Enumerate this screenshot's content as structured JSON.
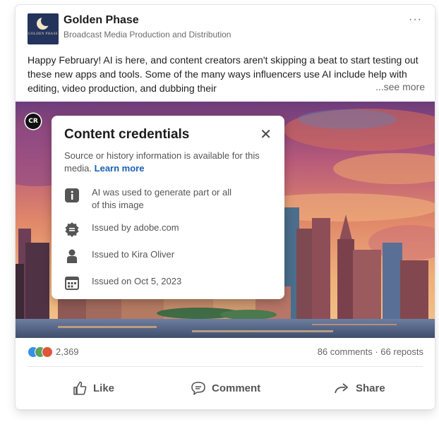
{
  "post": {
    "author": {
      "name": "Golden Phase",
      "subtitle": "Broadcast Media Production and Distribution",
      "logo_text": "GOLDEN PHASE"
    },
    "more_label": "···",
    "text": "Happy February! AI is here, and content creators aren't skipping a beat to start testing out these new apps and tools. Some of the many ways influencers use AI include help with editing, video production, and dubbing their",
    "see_more": "...see more"
  },
  "credentials": {
    "badge": "CR",
    "title": "Content credentials",
    "close": "✕",
    "description": "Source or history information is available for this media.",
    "learn_more": "Learn more",
    "items": [
      {
        "icon": "info-icon",
        "text_line1": "AI was used to generate part or all",
        "text_line2": "of this image"
      },
      {
        "icon": "seal-icon",
        "text_line1": "Issued by adobe.com"
      },
      {
        "icon": "person-icon",
        "text_line1": "Issued to Kira Oliver"
      },
      {
        "icon": "calendar-icon",
        "text_line1": "Issued on Oct 5, 2023"
      }
    ]
  },
  "social": {
    "reaction_icons": [
      "like-reaction-icon",
      "celebrate-reaction-icon",
      "love-reaction-icon"
    ],
    "reaction_count": "2,369",
    "engagement": "86 comments · 66 reposts"
  },
  "actions": {
    "like": "Like",
    "comment": "Comment",
    "share": "Share"
  },
  "colors": {
    "link": "#1a5fb4",
    "logo_bg": "#23335c"
  }
}
